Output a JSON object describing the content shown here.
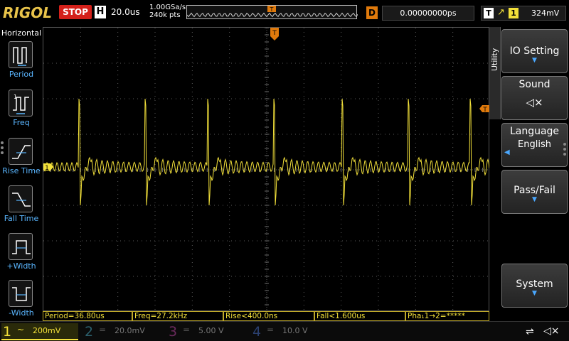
{
  "topbar": {
    "brand": "RIGOL",
    "run_state": "STOP",
    "h_label": "H",
    "timebase": "20.0us",
    "sample_rate": "1.00GSa/s",
    "memory_depth": "240k pts",
    "trigger_marker": "T",
    "delay_label": "D",
    "delay_value": "0.00000000ps",
    "trigger_label": "T",
    "trigger_edge": "↗",
    "trigger_source": "1",
    "trigger_level": "324mV"
  },
  "left_menu": {
    "title": "Horizontal",
    "items": [
      {
        "label": "Period",
        "icon": "period-icon"
      },
      {
        "label": "Freq",
        "icon": "frequency-icon"
      },
      {
        "label": "Rise Time",
        "icon": "rise-time-icon"
      },
      {
        "label": "Fall Time",
        "icon": "fall-time-icon"
      },
      {
        "label": "+Width",
        "icon": "positive-width-icon"
      },
      {
        "label": "-Width",
        "icon": "negative-width-icon"
      }
    ]
  },
  "right_menu": {
    "tab_label": "Utility",
    "items": [
      {
        "label": "IO Setting",
        "has_arrow": true
      },
      {
        "label": "Sound",
        "icon": "speaker-muted-icon"
      },
      {
        "label": "Language",
        "value": "English"
      },
      {
        "label": "Pass/Fail",
        "has_arrow": true
      },
      {
        "label": "System",
        "has_arrow": true
      }
    ]
  },
  "grid": {
    "channel_marker": "1",
    "trigger_level_marker": "T",
    "trigger_pos_marker": "T",
    "waveform_color": "#f2e03a"
  },
  "measurements": [
    {
      "text": "Period=36.80us"
    },
    {
      "text": "Freq=27.2kHz"
    },
    {
      "text": "Rise<400.0ns"
    },
    {
      "text": "Fall<1.600us"
    },
    {
      "text": "Pha₁1→2=*****"
    }
  ],
  "channels": [
    {
      "num": "1",
      "coupling": "~",
      "scale": "200mV",
      "color": "#f2e03a",
      "active": true
    },
    {
      "num": "2",
      "coupling": "=",
      "scale": "20.0mV",
      "color": "#2fa9c9",
      "active": false
    },
    {
      "num": "3",
      "coupling": "=",
      "scale": "5.00 V",
      "color": "#c83aa8",
      "active": false
    },
    {
      "num": "4",
      "coupling": "=",
      "scale": "10.0 V",
      "color": "#2d6cd6",
      "active": false
    }
  ],
  "status_icons": [
    "usb-icon",
    "sound-muted-icon"
  ]
}
